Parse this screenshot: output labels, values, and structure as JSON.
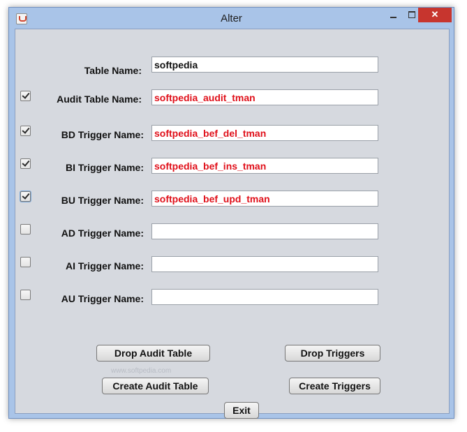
{
  "window": {
    "title": "Alter"
  },
  "controls": {
    "close": "✕"
  },
  "fields": [
    {
      "label": "Table Name:",
      "value": "softpedia",
      "checkbox": null
    },
    {
      "label": "Audit Table Name:",
      "value": "softpedia_audit_tman",
      "checkbox": true
    },
    {
      "label": "BD Trigger Name:",
      "value": "softpedia_bef_del_tman",
      "checkbox": true
    },
    {
      "label": "BI Trigger Name:",
      "value": "softpedia_bef_ins_tman",
      "checkbox": true
    },
    {
      "label": "BU Trigger Name:",
      "value": "softpedia_bef_upd_tman",
      "checkbox": true
    },
    {
      "label": "AD Trigger Name:",
      "value": "",
      "checkbox": false
    },
    {
      "label": "AI Trigger Name:",
      "value": "",
      "checkbox": false
    },
    {
      "label": "AU Trigger Name:",
      "value": "",
      "checkbox": false
    }
  ],
  "buttons": {
    "drop_audit_table": "Drop Audit Table",
    "drop_triggers": "Drop Triggers",
    "create_audit_table": "Create Audit Table",
    "create_triggers": "Create Triggers",
    "exit": "Exit"
  },
  "watermark": "www.softpedia.com",
  "colors": {
    "value_text": "#e0101a",
    "titlebar": "#a9c4e8",
    "panel": "#d6d9df",
    "close": "#c7352e"
  }
}
